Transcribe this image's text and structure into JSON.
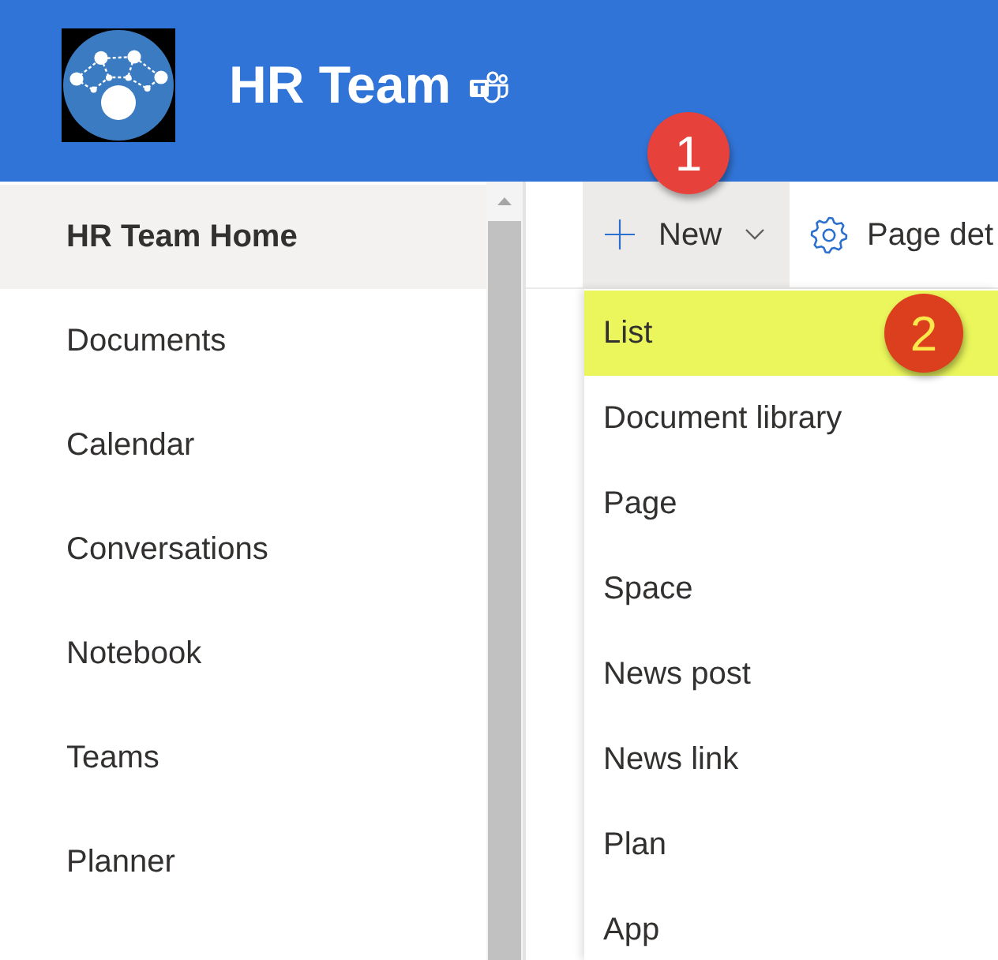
{
  "site": {
    "title": "HR Team"
  },
  "nav": {
    "items": [
      {
        "label": "HR Team Home",
        "selected": true
      },
      {
        "label": "Documents",
        "selected": false
      },
      {
        "label": "Calendar",
        "selected": false
      },
      {
        "label": "Conversations",
        "selected": false
      },
      {
        "label": "Notebook",
        "selected": false
      },
      {
        "label": "Teams",
        "selected": false
      },
      {
        "label": "Planner",
        "selected": false
      }
    ]
  },
  "command_bar": {
    "new_button": {
      "label": "New",
      "expanded": true,
      "callout": "1"
    },
    "page_details": {
      "label": "Page det"
    }
  },
  "new_menu": {
    "items": [
      {
        "label": "List",
        "selected": true,
        "callout": "2"
      },
      {
        "label": "Document library",
        "selected": false
      },
      {
        "label": "Page",
        "selected": false
      },
      {
        "label": "Space",
        "selected": false
      },
      {
        "label": "News post",
        "selected": false
      },
      {
        "label": "News link",
        "selected": false
      },
      {
        "label": "Plan",
        "selected": false
      },
      {
        "label": "App",
        "selected": false
      }
    ]
  }
}
